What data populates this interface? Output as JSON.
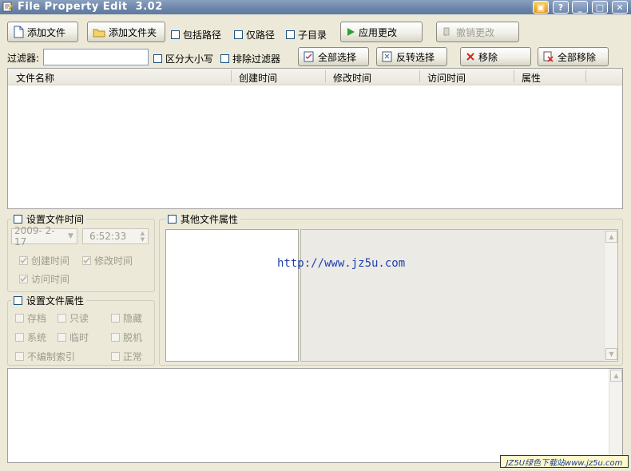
{
  "window": {
    "title": "File Property Edit  3.02"
  },
  "toolbar": {
    "add_file": "添加文件",
    "add_folder": "添加文件夹",
    "include_path": "包括路径",
    "path_only": "仅路径",
    "subdir": "子目录",
    "apply": "应用更改",
    "undo": "撤销更改"
  },
  "filter": {
    "label": "过滤器:",
    "value": "",
    "case_sensitive": "区分大小写",
    "exclude_filter": "排除过滤器",
    "select_all": "全部选择",
    "invert": "反转选择",
    "remove": "移除",
    "remove_all": "全部移除"
  },
  "filelist": {
    "columns": [
      "文件名称",
      "创建时间",
      "修改时间",
      "访问时间",
      "属性"
    ]
  },
  "time_group": {
    "title": "设置文件时间",
    "date": "2009- 2-17",
    "time": "6:52:33",
    "created": "创建时间",
    "modified": "修改时间",
    "accessed": "访问时间"
  },
  "attr_group": {
    "title": "设置文件属性",
    "items": [
      "存档",
      "只读",
      "隐藏",
      "系统",
      "临时",
      "脱机",
      "不编制索引",
      "正常"
    ]
  },
  "other_group": {
    "title": "其他文件属性",
    "watermark": "http://www.jz5u.com"
  },
  "footer": {
    "badge": "JZ5U绿色下载站www.jz5u.com"
  }
}
